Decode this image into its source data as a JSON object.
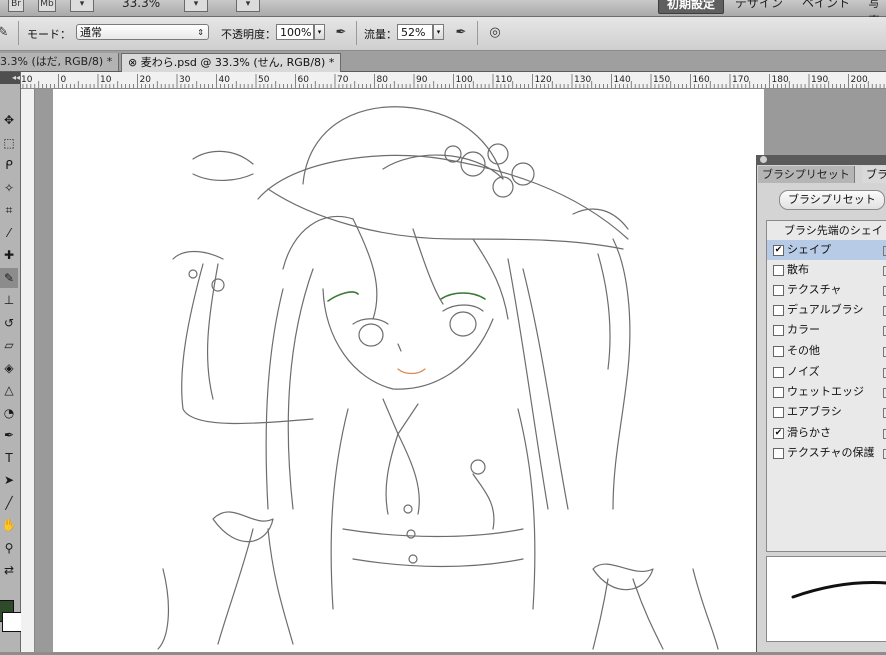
{
  "app_bar": {
    "br_label": "Br",
    "mb_label": "Mb",
    "zoom": "33.3%",
    "workspaces": [
      "初期設定",
      "デザイン",
      "ペイント",
      "写真"
    ]
  },
  "options": {
    "mode_label": "モード：",
    "mode_value": "通常",
    "opacity_label": "不透明度：",
    "opacity_value": "100%",
    "flow_label": "流量：",
    "flow_value": "52%"
  },
  "tabs": [
    {
      "label": "3.3% (はだ, RGB/8) *"
    },
    {
      "label": "麦わら.psd @ 33.3% (せん, RGB/8) *"
    }
  ],
  "ruler": {
    "ticks": [
      "10",
      "0",
      "10",
      "20",
      "30",
      "40",
      "50",
      "60",
      "70",
      "80",
      "90",
      "100",
      "110",
      "120",
      "130",
      "140",
      "150",
      "160",
      "170",
      "180",
      "190",
      "200"
    ]
  },
  "tools": [
    "move-icon",
    "marquee-icon",
    "lasso-icon",
    "quick-select-icon",
    "crop-icon",
    "eyedropper-icon",
    "healing-brush-icon",
    "brush-icon",
    "stamp-icon",
    "history-brush-icon",
    "eraser-icon",
    "paint-bucket-icon",
    "blur-icon",
    "dodge-icon",
    "pen-icon",
    "type-icon",
    "path-select-icon",
    "line-icon",
    "hand-icon",
    "zoom-icon",
    "swap-colors-icon"
  ],
  "colors": {
    "foreground": "#2f4a2a",
    "background": "#ffffff",
    "selection": "#b8cbe6"
  },
  "brush_panel": {
    "tabs": [
      "ブラシプリセット",
      "ブラ"
    ],
    "preset_button": "ブラシプリセット",
    "list_header": "ブラシ先端のシェイ",
    "items": [
      {
        "label": "シェイプ",
        "checked": true,
        "selected": true
      },
      {
        "label": "散布",
        "checked": false
      },
      {
        "label": "テクスチャ",
        "checked": false
      },
      {
        "label": "デュアルブラシ",
        "checked": false
      },
      {
        "label": "カラー",
        "checked": false
      },
      {
        "label": "その他",
        "checked": false
      },
      {
        "label": "ノイズ",
        "checked": false
      },
      {
        "label": "ウェットエッジ",
        "checked": false
      },
      {
        "label": "エアブラシ",
        "checked": false
      },
      {
        "label": "滑らかさ",
        "checked": true
      },
      {
        "label": "テクスチャの保護",
        "checked": false
      }
    ]
  }
}
